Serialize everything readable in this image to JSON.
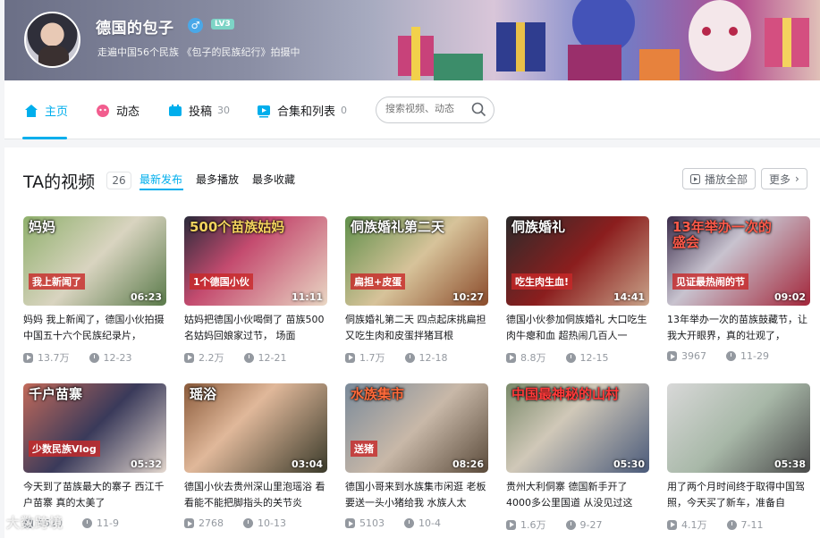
{
  "profile": {
    "name": "德国的包子",
    "gender_icon": "male-icon",
    "level": "LV3",
    "sign": "走遍中国56个民族 《包子的民族纪行》拍摄中"
  },
  "nav": {
    "tabs": [
      {
        "label": "主页",
        "count": "",
        "icon": "home-icon"
      },
      {
        "label": "动态",
        "count": "",
        "icon": "dynamic-icon"
      },
      {
        "label": "投稿",
        "count": "30",
        "icon": "upload-icon"
      },
      {
        "label": "合集和列表",
        "count": "0",
        "icon": "collection-icon"
      }
    ],
    "search_placeholder": "搜索视频、动态",
    "accent_color": "#00aeec"
  },
  "videos_section": {
    "title": "TA的视频",
    "count": "26",
    "sort_options": [
      "最新发布",
      "最多播放",
      "最多收藏"
    ],
    "play_all_label": "播放全部",
    "more_label": "更多"
  },
  "videos": [
    {
      "title": "妈妈 我上新闻了，德国小伙拍摄中国五十六个民族纪录片，",
      "duration": "06:23",
      "views": "13.7万",
      "date": "12-23",
      "cap1": "妈妈",
      "cap2": "我上新闻了"
    },
    {
      "title": "姑妈把德国小伙喝倒了 苗族500名姑妈回娘家过节， 场面",
      "duration": "11:11",
      "views": "2.2万",
      "date": "12-21",
      "cap1": "500个苗族姑妈",
      "cap2": "1个德国小伙"
    },
    {
      "title": "侗族婚礼第二天 四点起床挑扁担 又吃生肉和皮蛋拌猪耳根",
      "duration": "10:27",
      "views": "1.7万",
      "date": "12-18",
      "cap1": "侗族婚礼第二天",
      "cap2": "扁担+皮蛋"
    },
    {
      "title": "德国小伙参加侗族婚礼 大口吃生肉牛瘪和血 超热闹几百人一",
      "duration": "14:41",
      "views": "8.8万",
      "date": "12-15",
      "cap1": "侗族婚礼",
      "cap2": "吃生肉生血!"
    },
    {
      "title": "13年举办一次的苗族鼓藏节，让我大开眼界，真的壮观了，",
      "duration": "09:02",
      "views": "3967",
      "date": "11-29",
      "cap1": "13年举办一次的盛会",
      "cap2": "见证最热闹的节"
    },
    {
      "title": "今天到了苗族最大的寨子 西江千户苗寨 真的太美了",
      "duration": "05:32",
      "views": "5620",
      "date": "11-9",
      "cap1": "千户苗寨",
      "cap2": "少数民族Vlog"
    },
    {
      "title": "德国小伙去贵州深山里泡瑶浴 看看能不能把脚指头的关节炎",
      "duration": "03:04",
      "views": "2768",
      "date": "10-13",
      "cap1": "瑶浴",
      "cap2": ""
    },
    {
      "title": "德国小哥来到水族集市闲逛 老板要送一头小猪给我 水族人太",
      "duration": "08:26",
      "views": "5103",
      "date": "10-4",
      "cap1": "水族集市",
      "cap2": "送猪"
    },
    {
      "title": "贵州大利侗寨 德国新手开了4000多公里国道 从没见过这",
      "duration": "05:30",
      "views": "1.6万",
      "date": "9-27",
      "cap1": "中国最神秘的山村",
      "cap2": ""
    },
    {
      "title": "用了两个月时间终于取得中国驾照，今天买了新车，准备自",
      "duration": "05:38",
      "views": "4.1万",
      "date": "7-11",
      "cap1": "",
      "cap2": ""
    }
  ],
  "watermark": "大数跨境"
}
